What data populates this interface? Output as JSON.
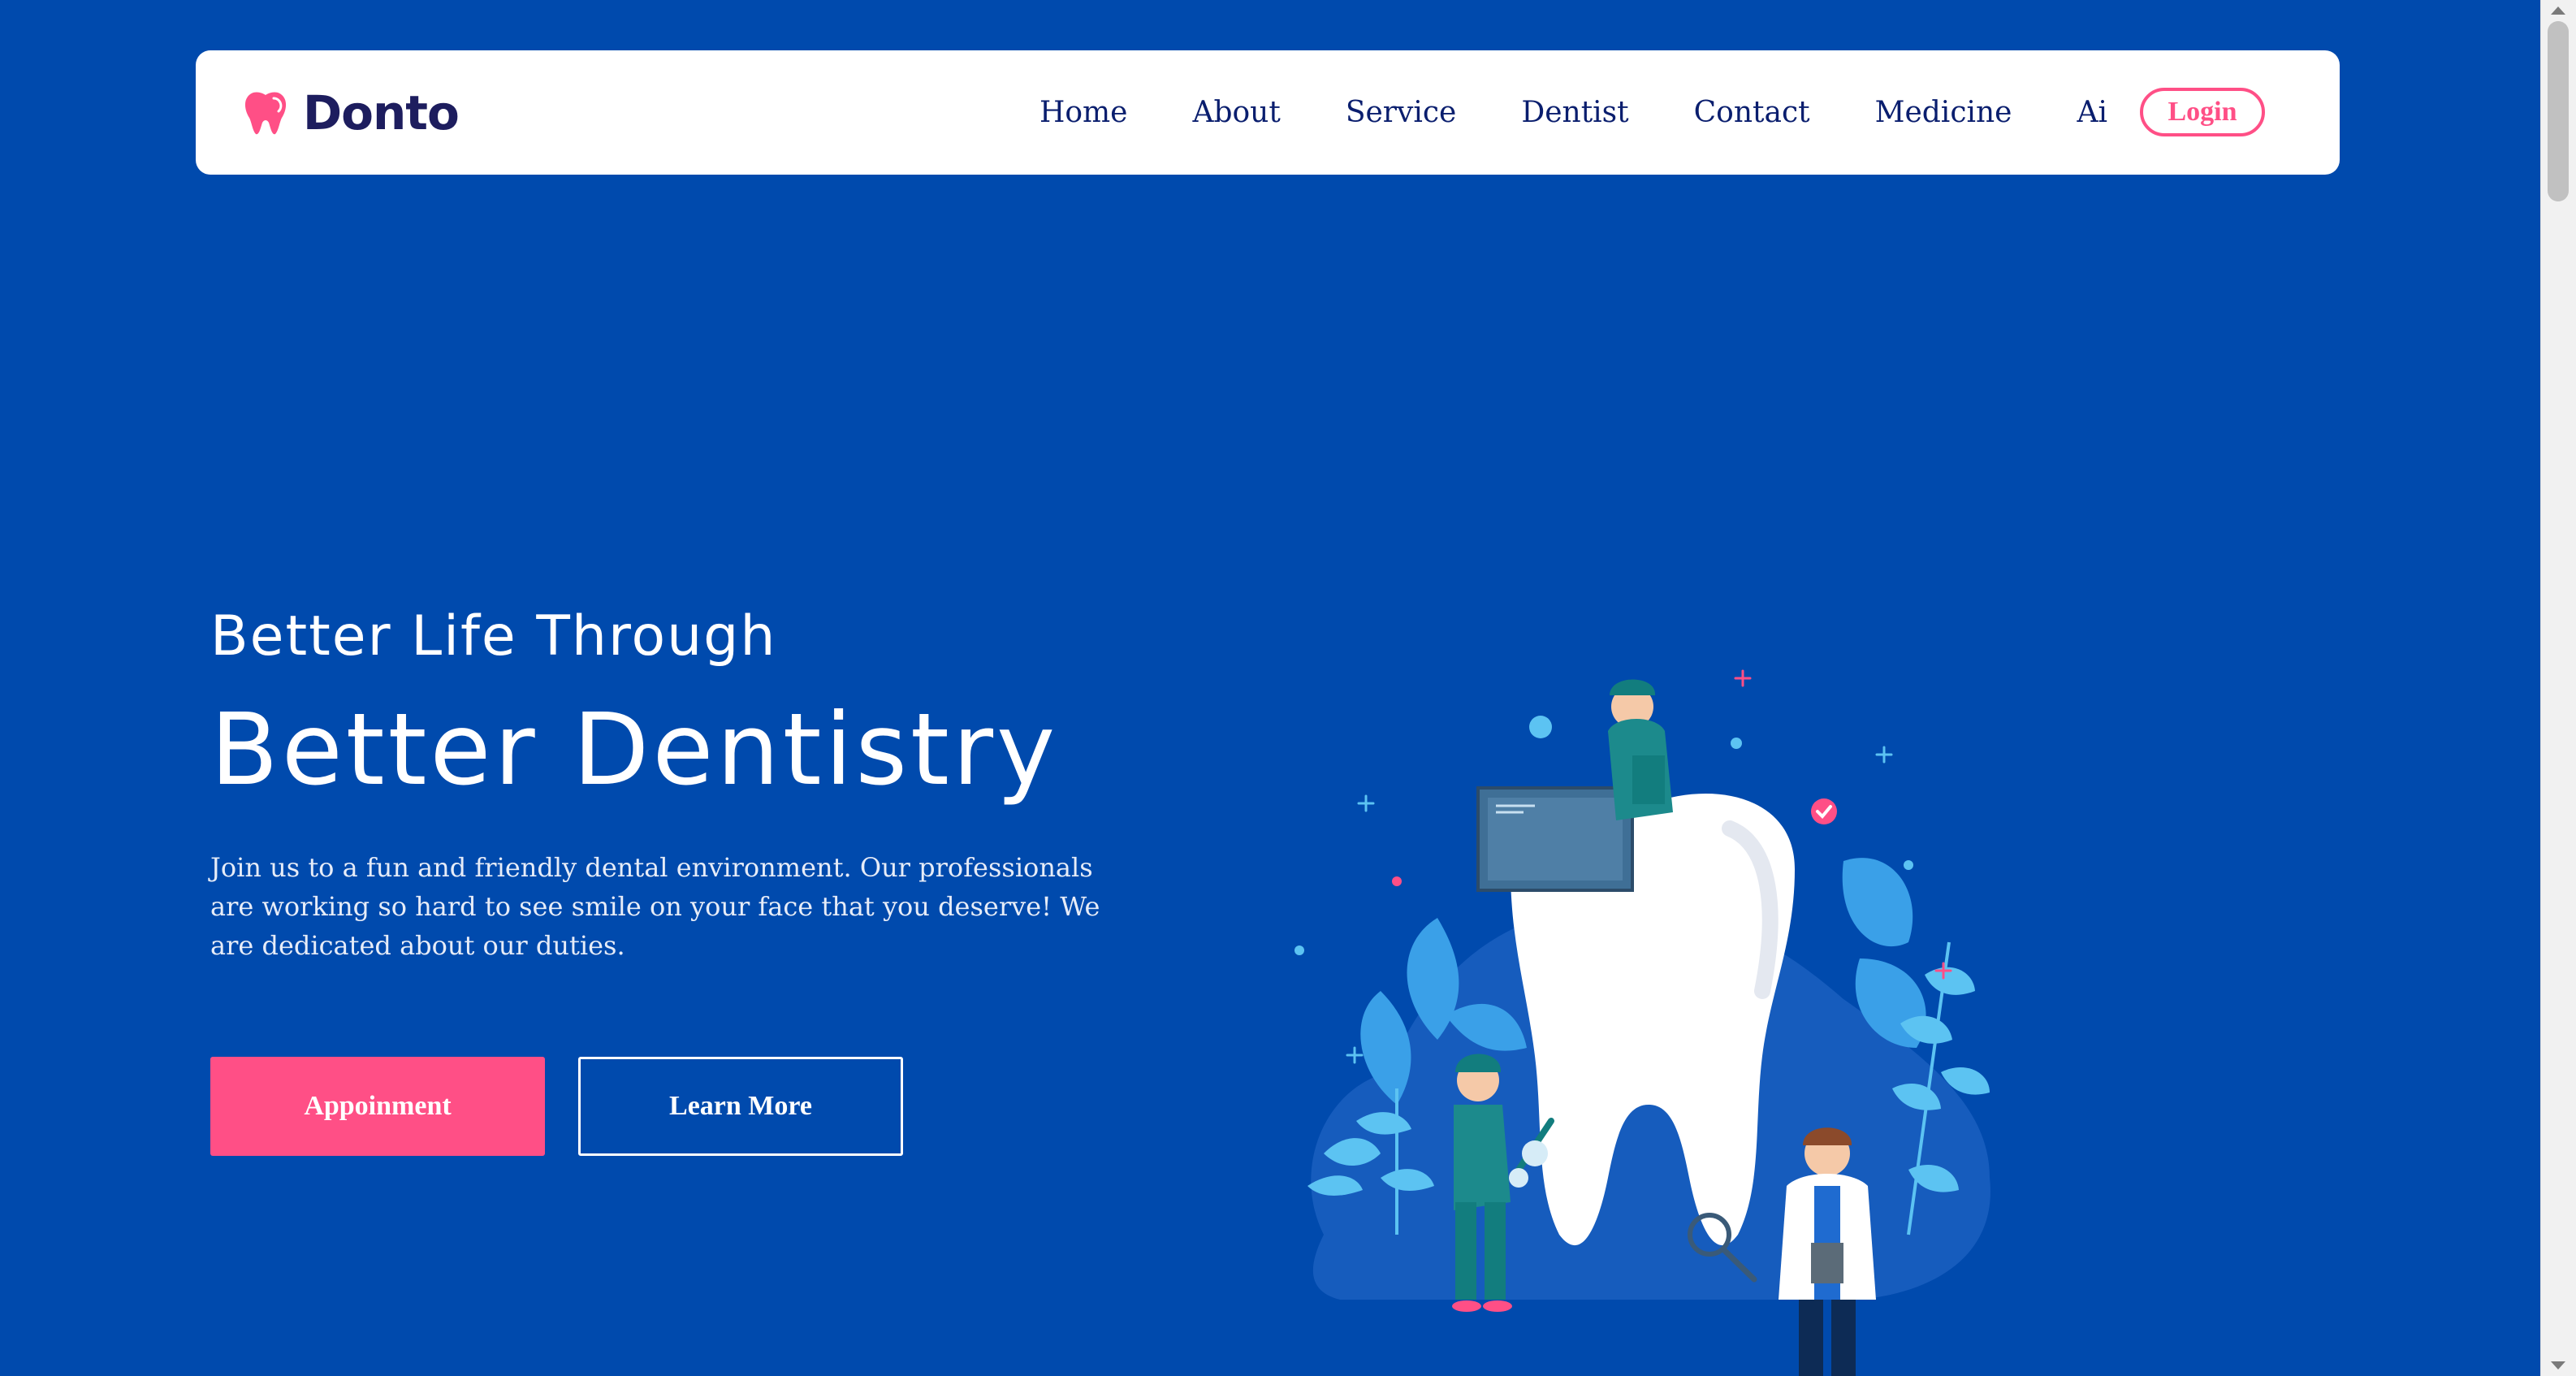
{
  "brand": {
    "name": "Donto",
    "logo_icon": "tooth-icon",
    "logo_color": "#ff4f86"
  },
  "nav": {
    "items": [
      {
        "label": "Home"
      },
      {
        "label": "About"
      },
      {
        "label": "Service"
      },
      {
        "label": "Dentist"
      },
      {
        "label": "Contact"
      },
      {
        "label": "Medicine"
      },
      {
        "label": "Ai"
      }
    ],
    "login_label": "Login"
  },
  "hero": {
    "subtitle": "Better Life Through",
    "title": "Better Dentistry",
    "description": "Join us to a fun and friendly dental environment. Our professionals are working so hard to see smile on your face that you deserve! We are dedicated about our duties.",
    "primary_button": "Appoinment",
    "secondary_button": "Learn More"
  },
  "colors": {
    "background": "#004aad",
    "accent": "#ff4f86",
    "nav_text": "#0a1e6e",
    "brand_text": "#1d1d5e"
  },
  "illustration": {
    "icon": "dental-team-illustration"
  }
}
